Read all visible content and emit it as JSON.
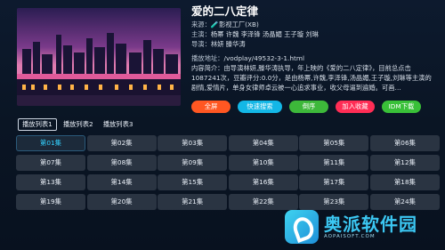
{
  "detail": {
    "title": "爱的二八定律",
    "source_label": "来源：",
    "source_value": "🧪影视工厂(XB)",
    "cast_label": "主演：",
    "cast_value": "杨幂 许魏 李泽锋 汤晶媚 王子璇 刘琳",
    "director_label": "导演：",
    "director_value": "林妍 滕华涛",
    "url_label": "播放地址：",
    "url_value": "/vodplay/49532-3-1.html",
    "intro_label": "内容简介：",
    "intro_text": "由导演林妍,滕华涛执导，年上映的《爱的二八定律》，目前总点击1087241次，豆瓣评分:0.0分，是由杨幂,许魏,李泽锋,汤晶媚,王子璇,刘琳等主演的剧情,爱情片，单身女律师卓云被一心追求事业，收父母逼到遍婚。可画…"
  },
  "actions": {
    "fullscreen": "全屏",
    "quick_search": "快速搜索",
    "reverse": "倒序",
    "favorite": "加入收藏",
    "idm": "IDM下载"
  },
  "tabs": [
    "播放列表1",
    "播放列表2",
    "播放列表3"
  ],
  "episodes": [
    "第01集",
    "第02集",
    "第03集",
    "第04集",
    "第05集",
    "第06集",
    "第07集",
    "第08集",
    "第09集",
    "第10集",
    "第11集",
    "第12集",
    "第13集",
    "第14集",
    "第15集",
    "第16集",
    "第17集",
    "第18集",
    "第19集",
    "第20集",
    "第21集",
    "第22集",
    "第23集",
    "第24集"
  ],
  "watermark": {
    "text": "奥派软件园",
    "sub": "AOPAISOFT.COM"
  }
}
